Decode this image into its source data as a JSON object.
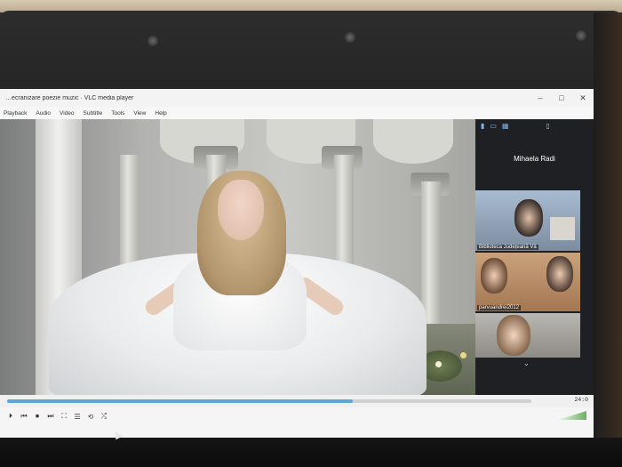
{
  "window": {
    "title": "…ecranizare poezie muzic · VLC media player",
    "minimize": "–",
    "maximize": "□",
    "close": "✕"
  },
  "menu": [
    "Playback",
    "Audio",
    "Video",
    "Subtitle",
    "Tools",
    "View",
    "Help"
  ],
  "player": {
    "time": "24:0",
    "progress_percent": 66,
    "controls": {
      "play": "⏵",
      "prev": "⏮",
      "stop": "⏹",
      "next": "⏭",
      "fullscreen": "⛶",
      "playlist": "☰",
      "loop": "⟲",
      "shuffle": "⤮"
    },
    "volume_level": 0.8
  },
  "meeting": {
    "host_name": "Mihaela Radi",
    "participants": [
      {
        "label": "Biblioteca Județeană Vâ"
      },
      {
        "label": "parvuandrei2012"
      },
      {
        "label": ""
      }
    ],
    "icons": [
      "video-icon",
      "grid-icon",
      "layout-icon"
    ]
  }
}
